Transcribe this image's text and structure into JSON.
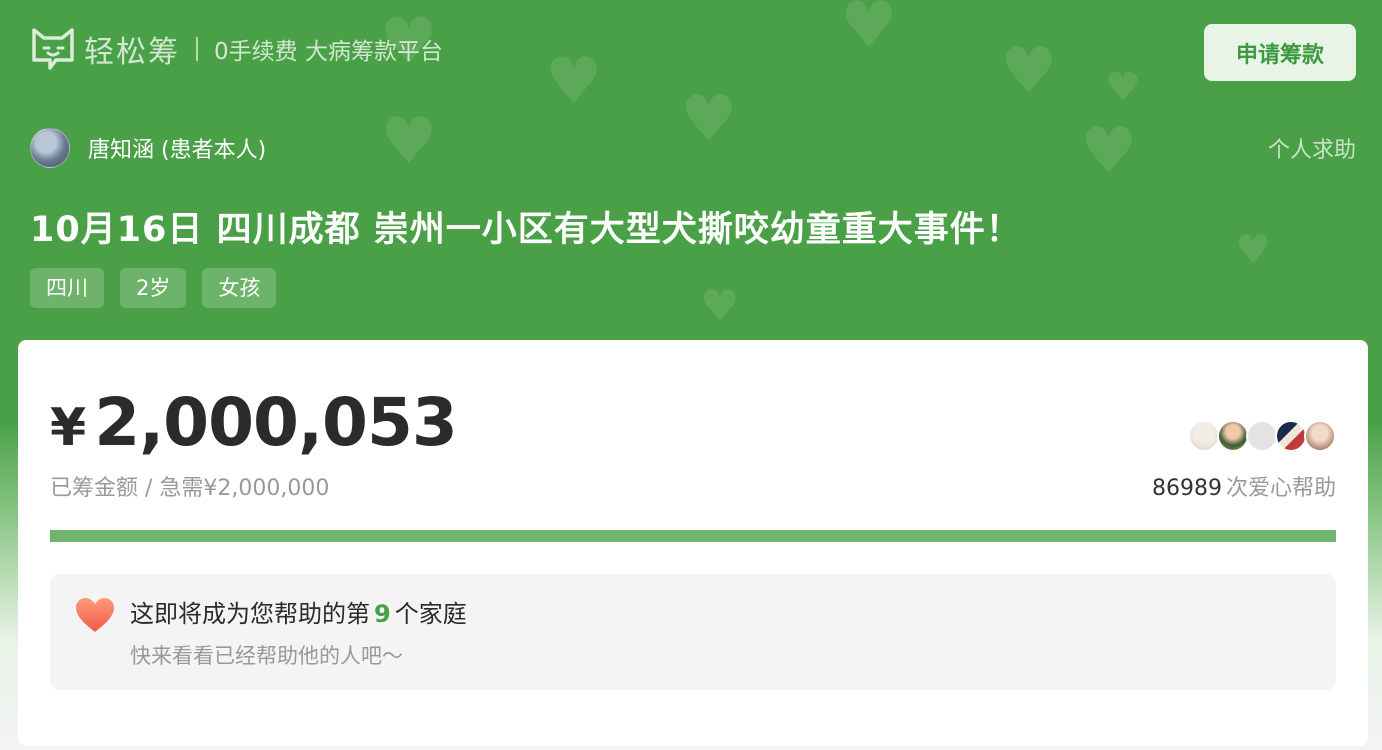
{
  "header": {
    "logo_text": "轻松筹",
    "slogan": "0手续费 大病筹款平台",
    "apply_button": "申请筹款"
  },
  "patient": {
    "name": "唐知涵 (患者本人)",
    "help_type": "个人求助"
  },
  "campaign": {
    "title": "10月16日 四川成都 崇州一小区有大型犬撕咬幼童重大事件！",
    "tags": [
      "四川",
      "2岁",
      "女孩"
    ]
  },
  "funding": {
    "currency_symbol": "¥",
    "raised": "2,000,053",
    "sub_label": "已筹金额 / 急需¥2,000,000",
    "help_count": "86989",
    "help_label": "次爱心帮助",
    "progress_fraction": 1.0
  },
  "hint": {
    "prefix": "这即将成为您帮助的第",
    "number": "9",
    "suffix": "个家庭",
    "sub": "快来看看已经帮助他的人吧～"
  },
  "colors": {
    "brand_green": "#4aa047",
    "progress": "#70b56e",
    "button_bg": "#e8f5e6"
  }
}
